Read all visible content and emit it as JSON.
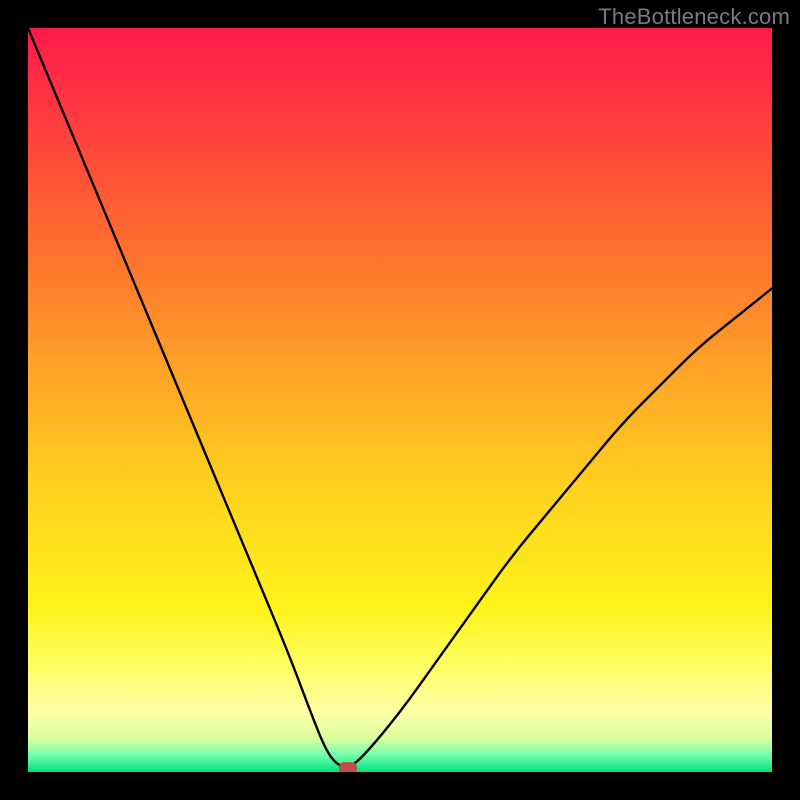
{
  "watermark": "TheBottleneck.com",
  "chart_data": {
    "type": "line",
    "title": "",
    "xlabel": "",
    "ylabel": "",
    "xlim": [
      0,
      100
    ],
    "ylim": [
      0,
      100
    ],
    "grid": false,
    "legend": null,
    "notes": "V-shaped bottleneck curve plotted over a vertical rainbow gradient (red top → green bottom). No axis ticks or labels are visible. A small red marker sits at the curve minimum.",
    "gradient_stops": [
      {
        "offset": 0.0,
        "color": "#ff1a4b"
      },
      {
        "offset": 0.12,
        "color": "#ff3b3f"
      },
      {
        "offset": 0.28,
        "color": "#ff6a2f"
      },
      {
        "offset": 0.45,
        "color": "#ffa028"
      },
      {
        "offset": 0.62,
        "color": "#ffd21f"
      },
      {
        "offset": 0.78,
        "color": "#fff31a"
      },
      {
        "offset": 0.86,
        "color": "#ffff66"
      },
      {
        "offset": 0.92,
        "color": "#ffffa8"
      },
      {
        "offset": 0.955,
        "color": "#d8ff9e"
      },
      {
        "offset": 0.975,
        "color": "#7dffb0"
      },
      {
        "offset": 1.0,
        "color": "#00e37a"
      }
    ],
    "series": [
      {
        "name": "bottleneck-curve",
        "x": [
          0,
          5,
          10,
          15,
          20,
          25,
          30,
          35,
          38,
          40,
          41.5,
          43,
          45,
          50,
          55,
          60,
          65,
          70,
          75,
          80,
          85,
          90,
          95,
          100
        ],
        "y": [
          100,
          88,
          76,
          64,
          52,
          40,
          28,
          16,
          8,
          3,
          1,
          0.5,
          2,
          8,
          15,
          22,
          29,
          35,
          41,
          47,
          52,
          57,
          61,
          65
        ]
      }
    ],
    "marker": {
      "x": 43,
      "y": 0.5,
      "color": "#c24a4a",
      "shape": "rounded"
    }
  }
}
